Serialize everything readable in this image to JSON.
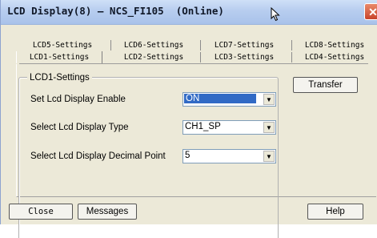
{
  "window": {
    "title": "LCD Display(8) — NCS_FI105  (Online)",
    "close_glyph": "✕"
  },
  "tabs": {
    "row1": [
      "LCD5-Settings",
      "LCD6-Settings",
      "LCD7-Settings",
      "LCD8-Settings"
    ],
    "row2": [
      "LCD1-Settings",
      "LCD2-Settings",
      "LCD3-Settings",
      "LCD4-Settings"
    ],
    "active": "LCD1-Settings"
  },
  "group": {
    "title": "LCD1-Settings",
    "fields": [
      {
        "label": "Set Lcd Display Enable",
        "value": "ON"
      },
      {
        "label": "Select Lcd Display Type",
        "value": "CH1_SP"
      },
      {
        "label": "Select Lcd Display Decimal Point",
        "value": "5"
      }
    ]
  },
  "buttons": {
    "transfer": "Transfer",
    "close": "Close",
    "messages": "Messages",
    "help": "Help"
  },
  "icons": {
    "dropdown": "chevron-down-icon",
    "cursor": "mouse-pointer-icon"
  }
}
